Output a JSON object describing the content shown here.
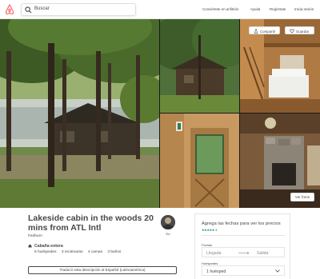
{
  "header": {
    "search_placeholder": "Buscar",
    "nav": {
      "host": "Conviértete en anfitrión",
      "help": "Ayuda",
      "signup": "Regístrate",
      "login": "Inicia sesión"
    }
  },
  "photos": {
    "share_label": "Compartir",
    "save_label": "Guardar",
    "view_photos_label": "Ver fotos"
  },
  "listing": {
    "title": "Lakeside cabin in the woods 20 mins from ATL Intl",
    "location": "Fairburn",
    "host_name": "Ed",
    "property_type": "Cabaña entera",
    "capacity": {
      "guests": "6 huéspedes",
      "bedrooms": "3 recámaras",
      "beds": "4 camas",
      "baths": "3 baños"
    },
    "translate_label": "Traducir esta descripción al Español (Latinoamérica)"
  },
  "booking": {
    "title": "Agrega las fechas para ver los precios",
    "stars": "★★★★★",
    "review_count": "3",
    "dates_label": "Fechas",
    "checkin_placeholder": "Llegada",
    "checkout_placeholder": "Salida",
    "guests_label": "Huéspedes",
    "guests_value": "1 huésped"
  },
  "colors": {
    "brand": "#ff5a5f",
    "text": "#484848",
    "stars": "#008489",
    "border": "#e4e4e4"
  },
  "icons": [
    "airbnb-logo",
    "search-icon",
    "share-icon",
    "heart-icon",
    "home-icon",
    "arrow-right-icon",
    "chevron-down-icon"
  ]
}
